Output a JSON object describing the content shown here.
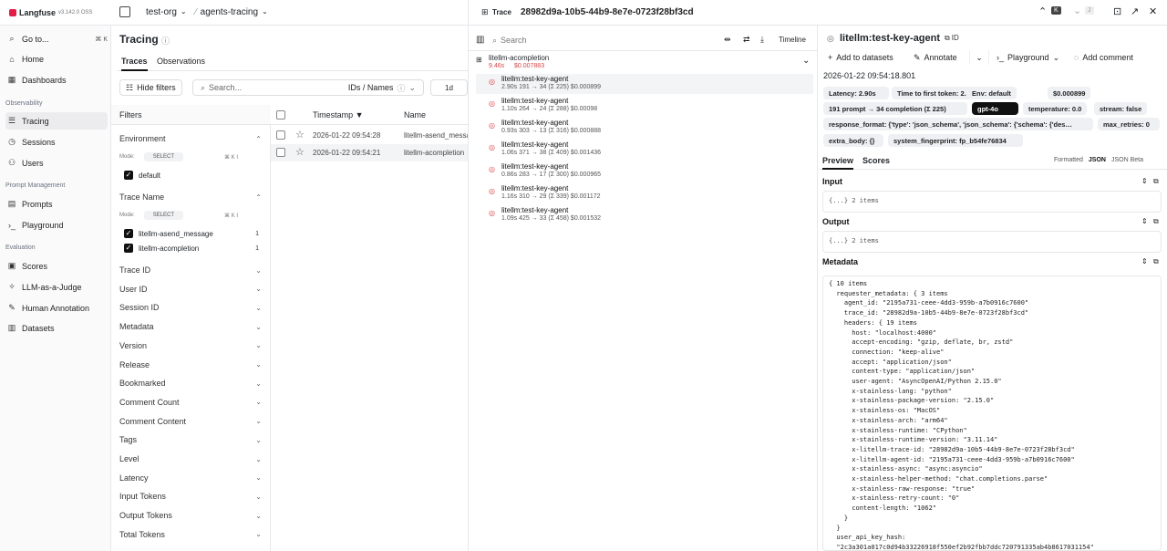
{
  "topbar": {
    "brand": "Langfuse",
    "version": "v3.142.0 OSS",
    "org": "test-org",
    "project": "agents-tracing"
  },
  "sidebar": {
    "goto": "Go to...",
    "goto_kbd": "⌘ K",
    "home": "Home",
    "dashboards": "Dashboards",
    "sec_observability": "Observability",
    "tracing": "Tracing",
    "sessions": "Sessions",
    "users": "Users",
    "sec_prompt": "Prompt Management",
    "prompts": "Prompts",
    "playground": "Playground",
    "sec_eval": "Evaluation",
    "scores": "Scores",
    "llm_judge": "LLM-as-a-Judge",
    "human_annotation": "Human Annotation",
    "datasets": "Datasets"
  },
  "page": {
    "title": "Tracing",
    "tab_traces": "Traces",
    "tab_observations": "Observations",
    "hide_filters": "Hide filters",
    "search_placeholder": "Search...",
    "ids_names": "IDs / Names",
    "range": "1d"
  },
  "filters": {
    "title": "Filters",
    "environment": "Environment",
    "mode": "Mode:",
    "select": "SELECT",
    "shortcut": "⌘ K I",
    "env_option": "default",
    "trace_name": "Trace Name",
    "opt1": "litellm-asend_message",
    "opt1_count": "1",
    "opt2": "litellm-acompletion",
    "opt2_count": "1",
    "rest": [
      "Trace ID",
      "User ID",
      "Session ID",
      "Metadata",
      "Version",
      "Release",
      "Bookmarked",
      "Comment Count",
      "Comment Content",
      "Tags",
      "Level",
      "Latency",
      "Input Tokens",
      "Output Tokens",
      "Total Tokens"
    ]
  },
  "table": {
    "col_timestamp": "Timestamp ▼",
    "col_name": "Name",
    "rows": [
      {
        "ts": "2026-01-22 09:54:28",
        "name": "litellm-asend_messa"
      },
      {
        "ts": "2026-01-22 09:54:21",
        "name": "litellm-acompletion"
      }
    ]
  },
  "trace": {
    "label": "Trace",
    "id": "28982d9a-10b5-44b9-8e7e-0723f28bf3cd",
    "kbd_k": "K",
    "kbd_j": "J",
    "search": "Search",
    "timeline": "Timeline",
    "root_name": "litellm-acompletion",
    "root_latency": "9.46s",
    "root_cost": "$0.007883",
    "spans": [
      {
        "name": "litellm:test-key-agent",
        "meta": "2.90s  191 → 34 (Σ 225)  $0.000899"
      },
      {
        "name": "litellm:test-key-agent",
        "meta": "1.10s  264 → 24 (Σ 288)  $0.00098"
      },
      {
        "name": "litellm:test-key-agent",
        "meta": "0.93s  303 → 13 (Σ 316)  $0.000888"
      },
      {
        "name": "litellm:test-key-agent",
        "meta": "1.06s  371 → 38 (Σ 409)  $0.001436"
      },
      {
        "name": "litellm:test-key-agent",
        "meta": "0.86s  283 → 17 (Σ 300)  $0.000965"
      },
      {
        "name": "litellm:test-key-agent",
        "meta": "1.16s  310 → 29 (Σ 339)  $0.001172"
      },
      {
        "name": "litellm:test-key-agent",
        "meta": "1.09s  425 → 33 (Σ 458)  $0.001532"
      }
    ]
  },
  "detail": {
    "title": "litellm:test-key-agent",
    "id_label": "ID",
    "add_datasets": "Add to datasets",
    "annotate": "Annotate",
    "playground": "Playground",
    "add_comment": "Add comment",
    "timestamp": "2026-01-22 09:54:18.801",
    "badges": [
      "Latency: 2.90s",
      "Time to first token: 2.90s",
      "Env: default",
      "$0.000899",
      "191 prompt → 34 completion (Σ 225)",
      "gpt-4o",
      "temperature: 0.0",
      "stream: false",
      "response_format: {'type': 'json_schema', 'json_schema': {'schema': {'des…",
      "max_retries: 0",
      "extra_body: {}",
      "system_fingerprint: fp_b54fe76834"
    ],
    "tab_preview": "Preview",
    "tab_scores": "Scores",
    "fmt_formatted": "Formatted",
    "fmt_json": "JSON",
    "fmt_beta": "JSON Beta",
    "input": "Input",
    "output": "Output",
    "collapsed": "{...} 2 items",
    "metadata": "Metadata",
    "code": [
      "{ 10 items",
      "  requester_metadata: { 3 items",
      "    agent_id: \"2195a731-ceee-4dd3-959b-a7b0916c7600\"",
      "    trace_id: \"28982d9a-10b5-44b9-8e7e-0723f28bf3cd\"",
      "    headers: { 19 items",
      "      host: \"localhost:4000\"",
      "      accept-encoding: \"gzip, deflate, br, zstd\"",
      "      connection: \"keep-alive\"",
      "      accept: \"application/json\"",
      "      content-type: \"application/json\"",
      "      user-agent: \"AsyncOpenAI/Python 2.15.0\"",
      "      x-stainless-lang: \"python\"",
      "      x-stainless-package-version: \"2.15.0\"",
      "      x-stainless-os: \"MacOS\"",
      "      x-stainless-arch: \"arm64\"",
      "      x-stainless-runtime: \"CPython\"",
      "      x-stainless-runtime-version: \"3.11.14\"",
      "      x-litellm-trace-id: \"28982d9a-10b5-44b9-8e7e-0723f28bf3cd\"",
      "      x-litellm-agent-id: \"2195a731-ceee-4dd3-959b-a7b0916c7600\"",
      "      x-stainless-async: \"async:asyncio\"",
      "      x-stainless-helper-method: \"chat.completions.parse\"",
      "      x-stainless-raw-response: \"true\"",
      "      x-stainless-retry-count: \"0\"",
      "      content-length: \"1062\"",
      "    }",
      "  }",
      "  user_api_key_hash:",
      "  \"2c3a301a017c0d94b33226918f550ef2b92fbb7ddc720791335ab4b8617031154\""
    ]
  }
}
